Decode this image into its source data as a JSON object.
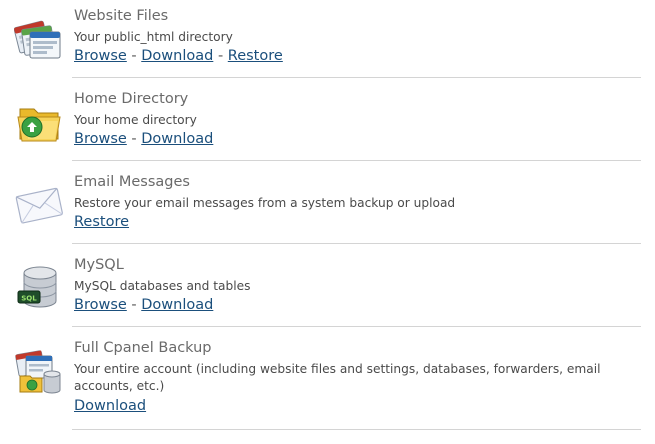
{
  "items": [
    {
      "title": "Website Files",
      "description": "Your public_html directory",
      "icon": "website-files-icon",
      "links": [
        "Browse",
        "Download",
        "Restore"
      ]
    },
    {
      "title": "Home Directory",
      "description": "Your home directory",
      "icon": "home-directory-folder-icon",
      "links": [
        "Browse",
        "Download"
      ]
    },
    {
      "title": "Email Messages",
      "description": "Restore your email messages from a system backup or upload",
      "icon": "email-envelope-icon",
      "links": [
        "Restore"
      ]
    },
    {
      "title": "MySQL",
      "description": "MySQL databases and tables",
      "icon": "mysql-database-icon",
      "links": [
        "Browse",
        "Download"
      ]
    },
    {
      "title": "Full Cpanel Backup",
      "description": "Your entire account (including website files and settings, databases, forwarders, email accounts, etc.)",
      "icon": "full-backup-icon",
      "links": [
        "Download"
      ]
    }
  ],
  "separator": "-",
  "icon_labels": {
    "sql": "SQL"
  },
  "colors": {
    "title": "#6a6a6a",
    "link": "#1b4f7c",
    "divider": "#d4d4d4"
  }
}
